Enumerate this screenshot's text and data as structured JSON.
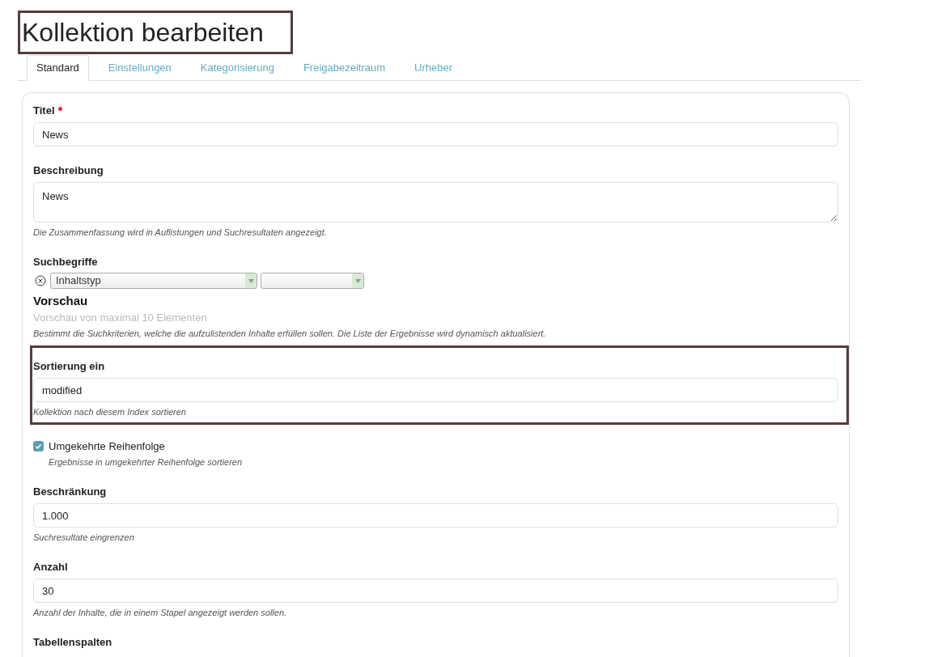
{
  "page": {
    "title": "Kollektion bearbeiten",
    "title_highlighted": true
  },
  "tabs": [
    {
      "label": "Standard",
      "selected": true
    },
    {
      "label": "Einstellungen",
      "selected": false
    },
    {
      "label": "Kategorisierung",
      "selected": false
    },
    {
      "label": "Freigabezeitraum",
      "selected": false
    },
    {
      "label": "Urheber",
      "selected": false
    }
  ],
  "fields": [
    {
      "kind": "text",
      "label": "Titel",
      "required": true,
      "value": "News"
    },
    {
      "kind": "textarea",
      "label": "Beschreibung",
      "value": "News",
      "help": "Die Zusammenfassung wird in Auflistungen und Suchresultaten angezeigt."
    },
    {
      "kind": "query",
      "label": "Suchbegriffe",
      "criterion": "Inhaltstyp",
      "preview_title": "Vorschau",
      "preview_text": "Vorschau von maximal 10 Elementen",
      "help": "Bestimmt die Suchkriterien, welche die aufzulistenden Inhalte erfüllen sollen. Die Liste der Ergebnisse wird dynamisch aktualisiert."
    },
    {
      "kind": "text",
      "label": "Sortierung ein",
      "value": "modified",
      "help": "Kollektion nach diesem Index sortieren",
      "highlighted": true
    },
    {
      "kind": "checkbox",
      "label": "Umgekehrte Reihenfolge",
      "checked": true,
      "help": "Ergebnisse in umgekehrter Reihenfolge sortieren"
    },
    {
      "kind": "text",
      "label": "Beschränkung",
      "value": "1.000",
      "help": "Suchresultate eingrenzen"
    },
    {
      "kind": "text",
      "label": "Anzahl",
      "value": "30",
      "help": "Anzahl der Inhalte, die in einem Stapel angezeigt werden sollen."
    },
    {
      "kind": "heading",
      "label": "Tabellenspalten"
    }
  ]
}
